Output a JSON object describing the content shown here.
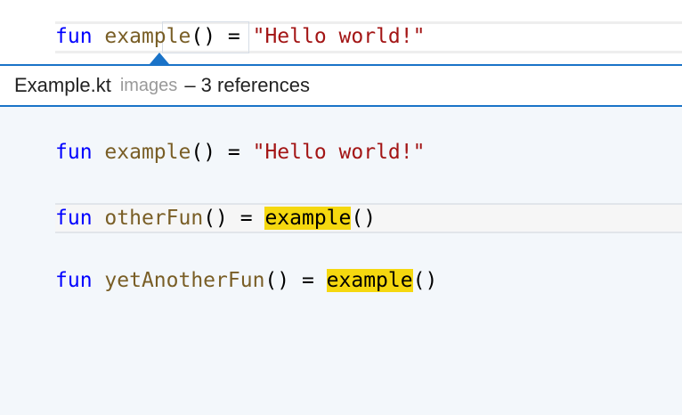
{
  "editor": {
    "code_line": {
      "keyword": "fun",
      "name": "example",
      "rest": "() = ",
      "string": "\"Hello world!\""
    }
  },
  "peek": {
    "header": {
      "file": "Example.kt",
      "folder": "images",
      "count": "– 3 references"
    },
    "lines": [
      {
        "keyword": "fun",
        "name": "example",
        "rest": "() = ",
        "string": "\"Hello world!\""
      },
      {
        "keyword": "fun",
        "name": "otherFun",
        "rest": "() = ",
        "ref": "example",
        "tail": "()"
      },
      {
        "keyword": "fun",
        "name": "yetAnotherFun",
        "rest": "() = ",
        "ref": "example",
        "tail": "()"
      }
    ]
  },
  "colors": {
    "keyword": "#0000ff",
    "function": "#795e26",
    "string": "#a31515",
    "highlight": "#f5d80f",
    "accent": "#1a73c8",
    "peek_background": "#f3f7fb"
  }
}
